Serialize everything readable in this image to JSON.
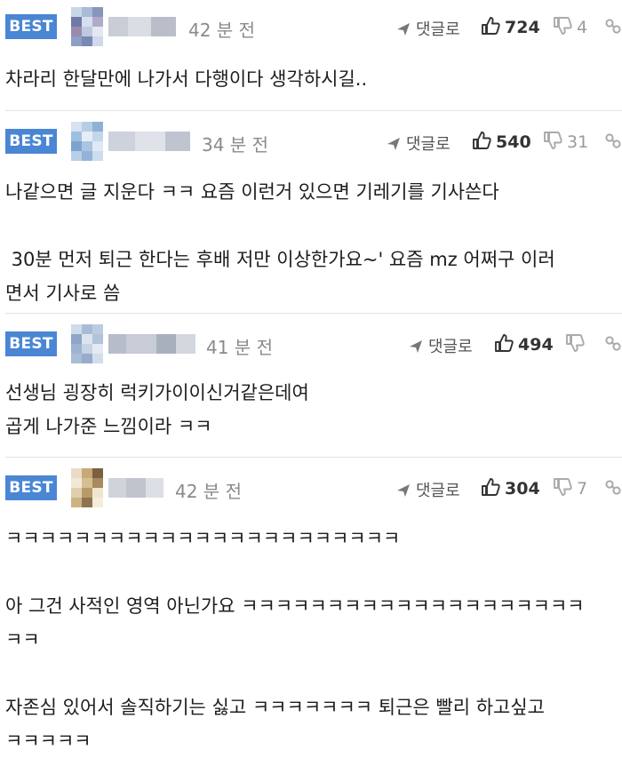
{
  "comments": [
    {
      "badge": "BEST",
      "time": "42 분 전",
      "reply_label": "댓글로",
      "likes": "724",
      "dislikes": "4",
      "body": "차라리 한달만에 나가서 다행이다 생각하시길..",
      "avatar_colors": [
        "#c9d6e8",
        "#a9bbd6",
        "#8696bd",
        "#6f7aa5",
        "#d7dfee",
        "#b2aacb",
        "#9a8ab0",
        "#c0c9dd",
        "#e2e7f2",
        "#8c9fc6",
        "#7a88b3",
        "#d0d8ea"
      ]
    },
    {
      "badge": "BEST",
      "time": "34 분 전",
      "reply_label": "댓글로",
      "likes": "540",
      "dislikes": "31",
      "body": "나같으면 글 지운다 ㅋㅋ 요즘 이런거 있으면 기레기를 기사쓴다\n\n 30분 먼저 퇴근 한다는 후배 저만 이상한가요~' 요즘 mz 어쩌구 이러\n면서 기사로 씀",
      "avatar_colors": [
        "#d6e3f0",
        "#b6cde6",
        "#8fb0d6",
        "#9ec0e0",
        "#e6edf5",
        "#c4d6ea",
        "#7ea3cf",
        "#aac4e2",
        "#dfe8f3",
        "#b9cfe7",
        "#93b4d8",
        "#cddcee"
      ]
    },
    {
      "badge": "BEST",
      "time": "41 분 전",
      "reply_label": "댓글로",
      "likes": "494",
      "dislikes": "",
      "body": "선생님 굉장히 럭키가이이신거같은데여\n곱게 나가준 느낌이라 ㅋㅋ",
      "avatar_colors": [
        "#cfdbe9",
        "#a7bcd7",
        "#bccce0",
        "#8fa6c8",
        "#dce4ef",
        "#b3c3da",
        "#9fb3d0",
        "#c7d3e4",
        "#e4eaf2",
        "#aabdd6",
        "#98acca",
        "#d3deeb"
      ]
    },
    {
      "badge": "BEST",
      "time": "42 분 전",
      "reply_label": "댓글로",
      "likes": "304",
      "dislikes": "7",
      "body": "ㅋㅋㅋㅋㅋㅋㅋㅋㅋㅋㅋㅋㅋㅋㅋㅋㅋㅋㅋㅋㅋㅋㅋ\n\n아 그건 사적인 영역 아닌가요 ㅋㅋㅋㅋㅋㅋㅋㅋㅋㅋㅋㅋㅋㅋㅋㅋㅋㅋㅋㅋ\nㅋㅋ\n\n자존심 있어서 솔직하기는 싫고 ㅋㅋㅋㅋㅋㅋㅋ 퇴근은 빨리 하고싶고\nㅋㅋㅋㅋㅋ",
      "avatar_colors": [
        "#e9dcc4",
        "#c8a878",
        "#7a6040",
        "#f2e8d6",
        "#d7be92",
        "#a88a5e",
        "#e0cfae",
        "#b89a6a",
        "#efe4cf",
        "#cdb384",
        "#8f7350",
        "#f5ecdc"
      ]
    }
  ],
  "colors": {
    "badge": "#4a86d4",
    "meta": "#8a8a8a",
    "divider": "#e3e3e3"
  },
  "icons": [
    "reply-arrow-icon",
    "thumbs-up-icon",
    "thumbs-down-icon",
    "share-link-icon"
  ]
}
